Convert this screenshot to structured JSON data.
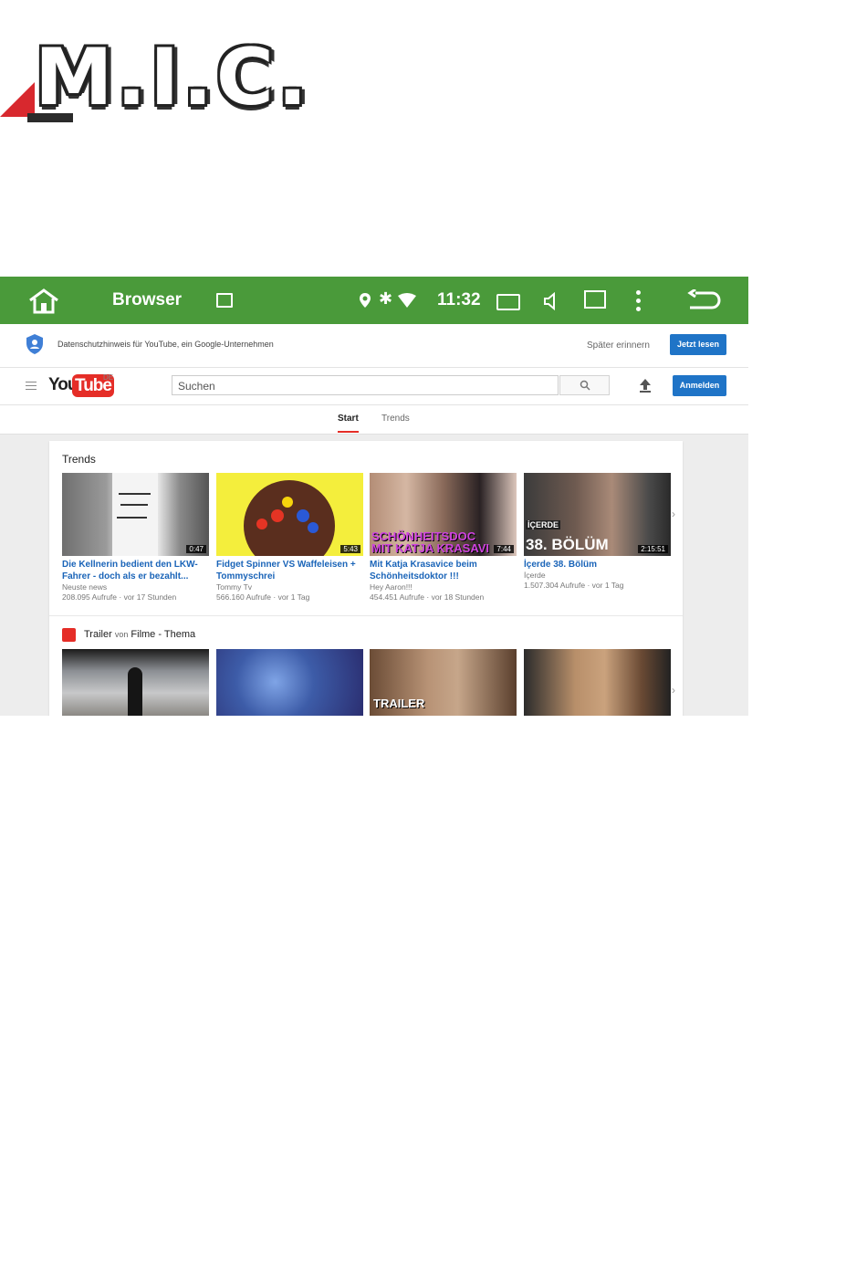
{
  "logo": {
    "text": "M.I.C."
  },
  "statusbar": {
    "app_title": "Browser",
    "time": "11:32",
    "bt_glyph": "✱"
  },
  "privacy": {
    "text": "Datenschutzhinweis für YouTube, ein Google-Unternehmen",
    "later_label": "Später erinnern",
    "read_label": "Jetzt lesen"
  },
  "yt": {
    "logo_you": "You",
    "logo_tube": "Tube",
    "region": "DE",
    "search_placeholder": "Suchen",
    "signin_label": "Anmelden"
  },
  "tabs": [
    {
      "label": "Start"
    },
    {
      "label": "Trends"
    }
  ],
  "trends": {
    "title": "Trends",
    "videos": [
      {
        "title": "Die Kellnerin bedient den LKW-Fahrer - doch als er bezahlt...",
        "channel": "Neuste news",
        "meta": "208.095 Aufrufe · vor 17 Stunden",
        "duration": "0:47"
      },
      {
        "title": "Fidget Spinner VS Waffeleisen + Tommyschrei",
        "channel": "Tommy Tv",
        "meta": "566.160 Aufrufe · vor 1 Tag",
        "duration": "5:43"
      },
      {
        "title": "Mit Katja Krasavice beim Schönheitsdoktor !!!",
        "channel": "Hey Aaron!!!",
        "meta": "454.451 Aufrufe · vor 18 Stunden",
        "duration": "7:44",
        "overlay": "SCHÖNHEITSDOC MIT KATJA KRASAVI"
      },
      {
        "title": "İçerde 38. Bölüm",
        "channel": "İçerde",
        "meta": "1.507.304 Aufrufe · vor 1 Tag",
        "duration": "2:15:51",
        "overlay_top": "İÇERDE",
        "overlay": "38. BÖLÜM"
      }
    ]
  },
  "trailer": {
    "title": "Trailer",
    "from": "von",
    "topic": "Filme - Thema",
    "thumb3_overlay": "TRAILER"
  },
  "colors": {
    "android_bar": "#4a9a3a",
    "yt_red": "#e52d27",
    "link_blue": "#1a64b8",
    "button_blue": "#1f74c7"
  }
}
